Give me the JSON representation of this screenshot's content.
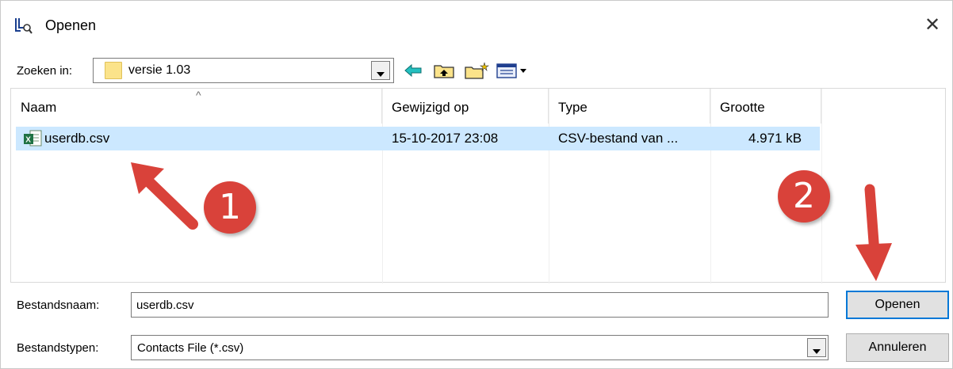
{
  "window": {
    "title": "Openen",
    "app_icon": "search-document-icon"
  },
  "lookin": {
    "label": "Zoeken in:",
    "value": "versie 1.03",
    "folder_icon": "folder-icon"
  },
  "toolbar": {
    "back_icon": "back-arrow-icon",
    "up_icon": "up-folder-icon",
    "new_icon": "new-folder-icon",
    "view_icon": "view-menu-icon"
  },
  "columns": [
    {
      "label": "Naam"
    },
    {
      "label": "Gewijzigd op"
    },
    {
      "label": "Type"
    },
    {
      "label": "Grootte"
    }
  ],
  "files": [
    {
      "name": "userdb.csv",
      "modified": "15-10-2017 23:08",
      "type": "CSV-bestand van ...",
      "size": "4.971 kB",
      "icon": "excel-csv-icon",
      "selected": true
    }
  ],
  "annotations": {
    "badge1": "1",
    "badge2": "2",
    "color": "#d9423a"
  },
  "filename": {
    "label": "Bestandsnaam:",
    "value": "userdb.csv"
  },
  "filetype": {
    "label": "Bestandstypen:",
    "value": "Contacts File (*.csv)"
  },
  "buttons": {
    "open": "Openen",
    "cancel": "Annuleren"
  },
  "colors": {
    "selection": "#cce8ff",
    "accent": "#0078d7"
  }
}
